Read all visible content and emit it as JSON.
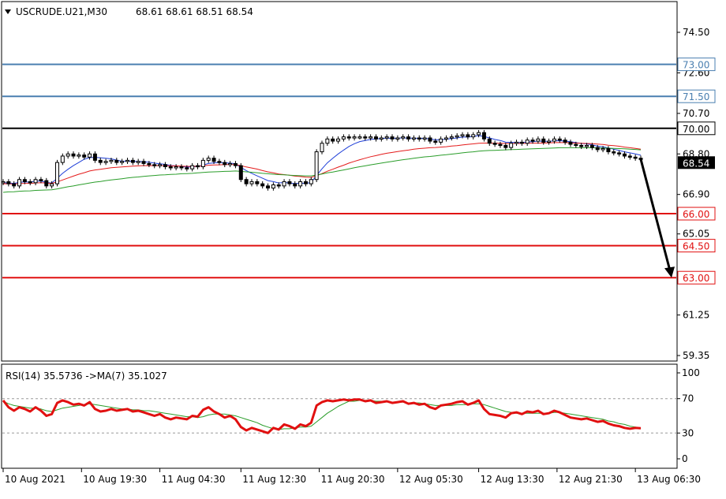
{
  "header": {
    "symbol": "USCRUDE.U21,M30",
    "ohlc": "68.61 68.61 68.51 68.54"
  },
  "indicator": {
    "label": "RSI(14) 35.5736   ->MA(7) 35.1027"
  },
  "colors": {
    "candle": "#000000",
    "ma_fast": "#1f3fd8",
    "ma_mid": "#e41b1b",
    "ma_slow": "#2a9d2a",
    "support": "#e11010",
    "resistance": "#4a7fb0",
    "pivot": "#000000",
    "rsi": "#e11010",
    "rsi_ma": "#2a9d2a",
    "current_price_bg": "#000000",
    "arrow": "#000000"
  },
  "chart_data": [
    {
      "type": "line",
      "title": "USCRUDE.U21,M30",
      "ylim": [
        59.35,
        75.5
      ],
      "y_ticks": [
        "74.50",
        "72.60",
        "70.70",
        "68.80",
        "66.90",
        "65.05",
        "61.25",
        "59.35"
      ],
      "x_ticks": [
        "10 Aug 2021",
        "10 Aug 19:30",
        "11 Aug 04:30",
        "11 Aug 12:30",
        "11 Aug 20:30",
        "12 Aug 05:30",
        "12 Aug 13:30",
        "12 Aug 21:30",
        "13 Aug 06:30"
      ],
      "levels": [
        {
          "value": 73.0,
          "label": "73.00",
          "kind": "resistance"
        },
        {
          "value": 71.5,
          "label": "71.50",
          "kind": "resistance"
        },
        {
          "value": 70.0,
          "label": "70.00",
          "kind": "pivot"
        },
        {
          "value": 66.0,
          "label": "66.00",
          "kind": "support"
        },
        {
          "value": 64.5,
          "label": "64.50",
          "kind": "support"
        },
        {
          "value": 63.0,
          "label": "63.00",
          "kind": "support"
        }
      ],
      "current_price": {
        "value": 68.54,
        "label": "68.54"
      },
      "forecast_arrow": {
        "from_bar": 118,
        "from_value": 68.55,
        "to_value": 63.0
      },
      "close": [
        67.5,
        67.4,
        67.3,
        67.6,
        67.5,
        67.45,
        67.6,
        67.55,
        67.3,
        67.4,
        68.4,
        68.7,
        68.8,
        68.7,
        68.75,
        68.65,
        68.8,
        68.5,
        68.4,
        68.45,
        68.5,
        68.4,
        68.45,
        68.5,
        68.4,
        68.45,
        68.35,
        68.3,
        68.25,
        68.3,
        68.2,
        68.15,
        68.2,
        68.15,
        68.1,
        68.25,
        68.2,
        68.5,
        68.6,
        68.45,
        68.4,
        68.3,
        68.35,
        68.25,
        67.6,
        67.4,
        67.5,
        67.4,
        67.3,
        67.2,
        67.35,
        67.3,
        67.5,
        67.4,
        67.3,
        67.5,
        67.4,
        67.6,
        68.9,
        69.3,
        69.5,
        69.4,
        69.5,
        69.6,
        69.55,
        69.6,
        69.6,
        69.55,
        69.6,
        69.5,
        69.55,
        69.6,
        69.5,
        69.55,
        69.6,
        69.5,
        69.55,
        69.5,
        69.55,
        69.4,
        69.35,
        69.5,
        69.55,
        69.6,
        69.65,
        69.7,
        69.6,
        69.7,
        69.8,
        69.5,
        69.3,
        69.25,
        69.2,
        69.1,
        69.3,
        69.35,
        69.3,
        69.45,
        69.4,
        69.5,
        69.35,
        69.4,
        69.5,
        69.45,
        69.35,
        69.25,
        69.2,
        69.15,
        69.2,
        69.1,
        69.0,
        69.05,
        68.9,
        68.85,
        68.8,
        68.7,
        68.65,
        68.6,
        68.54
      ],
      "series": [
        {
          "name": "MA fast",
          "values": [
            67.45,
            67.44,
            67.42,
            67.47,
            67.49,
            67.48,
            67.52,
            67.53,
            67.46,
            67.44,
            67.66,
            67.89,
            68.08,
            68.25,
            68.4,
            68.55,
            68.63,
            68.64,
            68.62,
            68.6,
            68.57,
            68.51,
            68.46,
            68.47,
            68.45,
            68.45,
            68.43,
            68.41,
            68.37,
            68.34,
            68.31,
            68.26,
            68.24,
            68.22,
            68.18,
            68.2,
            68.2,
            68.28,
            68.35,
            68.38,
            68.4,
            68.38,
            68.37,
            68.34,
            68.17,
            68.02,
            67.89,
            67.77,
            67.66,
            67.55,
            67.5,
            67.44,
            67.46,
            67.44,
            67.41,
            67.43,
            67.42,
            67.46,
            67.79,
            68.1,
            68.38,
            68.6,
            68.8,
            68.98,
            69.15,
            69.28,
            69.38,
            69.43,
            69.48,
            69.5,
            69.52,
            69.54,
            69.53,
            69.54,
            69.55,
            69.54,
            69.54,
            69.53,
            69.53,
            69.5,
            69.46,
            69.47,
            69.49,
            69.52,
            69.55,
            69.59,
            69.59,
            69.62,
            69.66,
            69.62,
            69.55,
            69.48,
            69.43,
            69.35,
            69.34,
            69.34,
            69.33,
            69.36,
            69.37,
            69.4,
            69.39,
            69.39,
            69.41,
            69.42,
            69.4,
            69.37,
            69.33,
            69.29,
            69.27,
            69.23,
            69.16,
            69.13,
            69.08,
            69.02,
            68.96,
            68.9,
            68.85,
            68.8,
            68.74
          ]
        },
        {
          "name": "MA mid",
          "values": [
            67.4,
            67.4,
            67.39,
            67.41,
            67.42,
            67.42,
            67.44,
            67.45,
            67.43,
            67.42,
            67.49,
            67.58,
            67.67,
            67.76,
            67.85,
            67.92,
            68.0,
            68.05,
            68.08,
            68.12,
            68.15,
            68.17,
            68.19,
            68.21,
            68.23,
            68.24,
            68.25,
            68.25,
            68.25,
            68.25,
            68.25,
            68.24,
            68.24,
            68.23,
            68.22,
            68.22,
            68.22,
            68.24,
            68.27,
            68.28,
            68.29,
            68.3,
            68.3,
            68.3,
            68.25,
            68.19,
            68.14,
            68.09,
            68.02,
            67.96,
            67.91,
            67.86,
            67.83,
            67.8,
            67.76,
            67.74,
            67.71,
            67.7,
            67.78,
            67.88,
            67.99,
            68.08,
            68.18,
            68.27,
            68.37,
            68.45,
            68.53,
            68.6,
            68.67,
            68.72,
            68.78,
            68.83,
            68.87,
            68.91,
            68.95,
            68.98,
            69.02,
            69.05,
            69.07,
            69.09,
            69.1,
            69.12,
            69.14,
            69.17,
            69.19,
            69.22,
            69.25,
            69.27,
            69.3,
            69.31,
            69.31,
            69.31,
            69.3,
            69.29,
            69.29,
            69.29,
            69.29,
            69.3,
            69.31,
            69.31,
            69.31,
            69.32,
            69.33,
            69.33,
            69.33,
            69.32,
            69.31,
            69.3,
            69.29,
            69.28,
            69.26,
            69.24,
            69.21,
            69.19,
            69.16,
            69.12,
            69.09,
            69.06,
            69.02
          ]
        },
        {
          "name": "MA slow",
          "values": [
            67.0,
            67.02,
            67.03,
            67.05,
            67.06,
            67.07,
            67.09,
            67.1,
            67.11,
            67.12,
            67.16,
            67.21,
            67.26,
            67.3,
            67.35,
            67.39,
            67.44,
            67.48,
            67.51,
            67.55,
            67.58,
            67.61,
            67.64,
            67.67,
            67.7,
            67.72,
            67.75,
            67.77,
            67.79,
            67.81,
            67.82,
            67.84,
            67.85,
            67.87,
            67.88,
            67.89,
            67.91,
            67.93,
            67.95,
            67.96,
            67.97,
            67.98,
            67.99,
            68.0,
            67.98,
            67.96,
            67.94,
            67.92,
            67.89,
            67.87,
            67.85,
            67.83,
            67.82,
            67.8,
            67.79,
            67.78,
            67.77,
            67.77,
            67.81,
            67.86,
            67.91,
            67.95,
            68.0,
            68.05,
            68.1,
            68.15,
            68.2,
            68.24,
            68.29,
            68.33,
            68.37,
            68.41,
            68.45,
            68.49,
            68.53,
            68.56,
            68.6,
            68.63,
            68.66,
            68.68,
            68.71,
            68.74,
            68.76,
            68.79,
            68.82,
            68.85,
            68.88,
            68.9,
            68.93,
            68.95,
            68.96,
            68.97,
            68.98,
            68.99,
            69.0,
            69.01,
            69.02,
            69.03,
            69.04,
            69.05,
            69.06,
            69.07,
            69.08,
            69.09,
            69.09,
            69.09,
            69.09,
            69.09,
            69.09,
            69.09,
            69.08,
            69.08,
            69.07,
            69.06,
            69.05,
            69.04,
            69.02,
            69.01,
            68.99
          ]
        }
      ]
    },
    {
      "type": "line",
      "title": "RSI(14) 35.5736   ->MA(7) 35.1027",
      "ylim": [
        0,
        100
      ],
      "y_ticks": [
        "100",
        "70",
        "30",
        "0"
      ],
      "levels": [
        70,
        30
      ],
      "series": [
        {
          "name": "RSI(14)",
          "values": [
            68,
            60,
            56,
            60,
            58,
            55,
            60,
            56,
            50,
            52,
            65,
            68,
            66,
            63,
            64,
            62,
            66,
            58,
            55,
            56,
            58,
            56,
            57,
            58,
            55,
            56,
            54,
            52,
            50,
            52,
            48,
            46,
            48,
            47,
            46,
            50,
            49,
            57,
            60,
            55,
            52,
            48,
            50,
            46,
            37,
            33,
            36,
            34,
            32,
            30,
            36,
            34,
            40,
            38,
            35,
            40,
            38,
            42,
            62,
            66,
            68,
            67,
            68,
            69,
            68,
            69,
            69,
            67,
            68,
            65,
            66,
            67,
            65,
            66,
            67,
            64,
            65,
            63,
            64,
            60,
            58,
            62,
            63,
            64,
            66,
            67,
            63,
            65,
            68,
            58,
            52,
            51,
            50,
            48,
            53,
            54,
            52,
            55,
            54,
            56,
            52,
            53,
            56,
            54,
            51,
            48,
            47,
            46,
            47,
            45,
            43,
            44,
            41,
            39,
            38,
            36,
            35,
            36,
            35.57
          ]
        },
        {
          "name": "MA(7)",
          "values": [
            67,
            64,
            62,
            61,
            60,
            59,
            59,
            58,
            56,
            55,
            57,
            59,
            60,
            61,
            62,
            63,
            64,
            63,
            62,
            61,
            60,
            59,
            58,
            58,
            57,
            57,
            56,
            56,
            55,
            54,
            53,
            52,
            51,
            50,
            49,
            49,
            48,
            49,
            51,
            52,
            52,
            52,
            51,
            50,
            48,
            46,
            44,
            42,
            39,
            37,
            35,
            34,
            35,
            35,
            36,
            37,
            37,
            38,
            43,
            48,
            53,
            57,
            61,
            64,
            67,
            67,
            68,
            68,
            68,
            67,
            67,
            67,
            66,
            66,
            66,
            65,
            65,
            65,
            64,
            63,
            62,
            62,
            62,
            62,
            63,
            63,
            63,
            64,
            64,
            63,
            61,
            59,
            57,
            55,
            54,
            53,
            53,
            53,
            53,
            53,
            53,
            53,
            54,
            54,
            53,
            52,
            51,
            50,
            49,
            48,
            47,
            46,
            44,
            43,
            41,
            40,
            38,
            37,
            35.1
          ]
        }
      ]
    }
  ]
}
